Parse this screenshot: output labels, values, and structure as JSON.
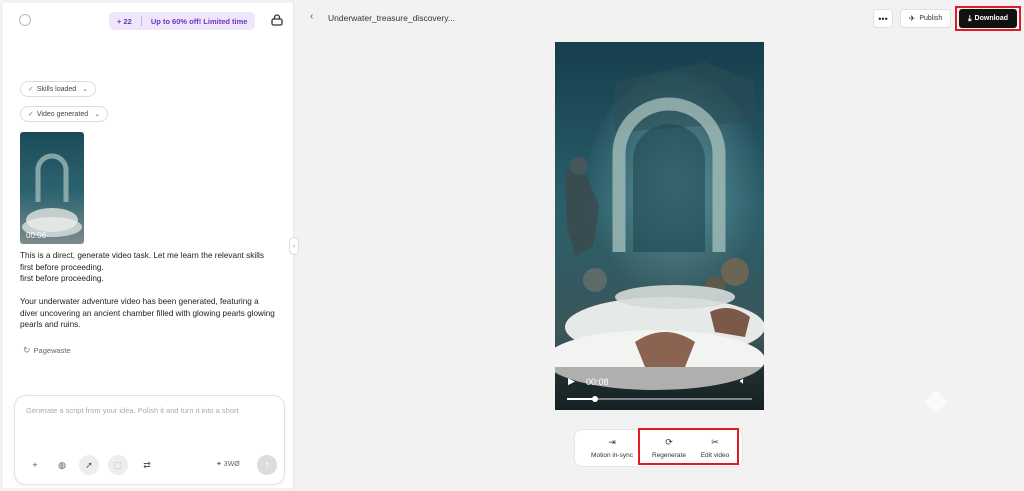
{
  "sidebar": {
    "promo": {
      "count": "+ 22",
      "offer": "Up to 60% off! Limited time"
    },
    "chips": [
      {
        "label": "Skills loaded"
      },
      {
        "label": "Video generated"
      }
    ],
    "thumbnail": {
      "duration": "00:06"
    },
    "messages": [
      "This is a direct, generate video task. Let me learn the relevant skills first before proceeding.",
      "first before proceeding.",
      "Your underwater adventure video has been generated, featuring a diver uncovering an ancient chamber filled with glowing pearls glowing pearls and ruins."
    ],
    "regen_link": "Pagewaste",
    "composer": {
      "placeholder": "Generate a script from your idea. Polish it and turn it into a short",
      "mode_label": "✦ 3WØ"
    }
  },
  "header": {
    "title": "Underwater_treasure_discovery...",
    "more_label": "•••",
    "publish_label": "Publish",
    "download_label": "Download"
  },
  "player": {
    "time": "00:08",
    "progress": 0.15
  },
  "actions": [
    {
      "label": "Motion in-sync",
      "icon": "motion-sync-icon"
    },
    {
      "label": "Regenerate",
      "icon": "refresh-icon"
    },
    {
      "label": "Edit video",
      "icon": "scissors-icon"
    }
  ],
  "colors": {
    "accent": "#7c4ddb",
    "highlight": "#e01b24",
    "download_bg": "#111111"
  }
}
